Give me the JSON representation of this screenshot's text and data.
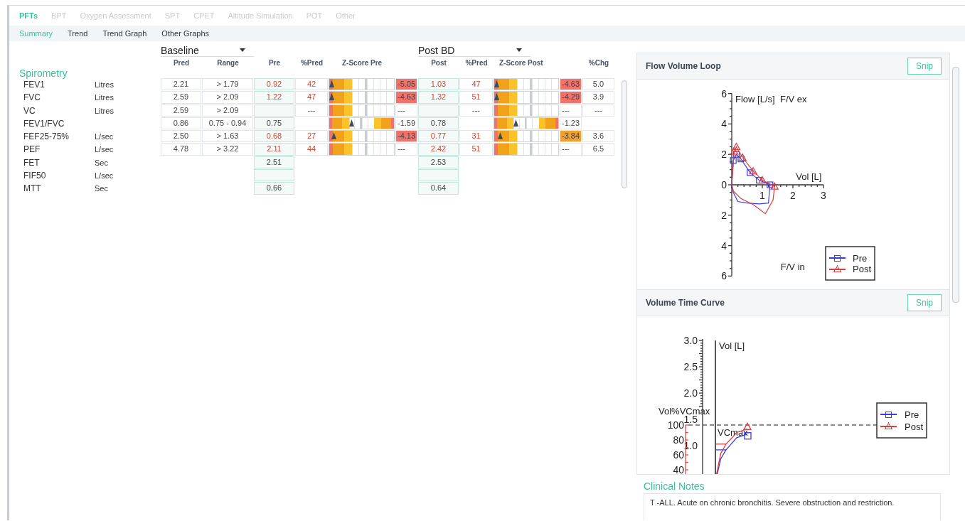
{
  "top_tabs": [
    {
      "label": "PFTs",
      "selected": true
    },
    {
      "label": "BPT",
      "selected": false
    },
    {
      "label": "Oxygen Assessment",
      "selected": false
    },
    {
      "label": "SPT",
      "selected": false
    },
    {
      "label": "CPET",
      "selected": false
    },
    {
      "label": "Altitude Simulation",
      "selected": false
    },
    {
      "label": "POT",
      "selected": false
    },
    {
      "label": "Other",
      "selected": false
    }
  ],
  "sub_tabs": [
    {
      "label": "Summary",
      "selected": true
    },
    {
      "label": "Trend",
      "selected": false
    },
    {
      "label": "Trend Graph",
      "selected": false
    },
    {
      "label": "Other Graphs",
      "selected": false
    }
  ],
  "baseline_select": {
    "value": "Baseline"
  },
  "post_select": {
    "value": "Post BD"
  },
  "columns": [
    "Pred",
    "Range",
    "Pre",
    "%Pred",
    "Z-Score Pre",
    "Post",
    "%Pred",
    "Z-Score Post",
    "%Chg"
  ],
  "section": "Spirometry",
  "rows": [
    {
      "name": "FEV1",
      "unit": "Litres",
      "pred": "2.21",
      "range": "> 1.79",
      "pre": {
        "text": "0.92",
        "low": true
      },
      "pre_pct": {
        "text": "42",
        "low": true
      },
      "z_pre": {
        "kind": "lower",
        "level": 0,
        "text": "-5.05",
        "color": "#f0726a"
      },
      "post": {
        "text": "1.03",
        "low": true
      },
      "post_pct": {
        "text": "47",
        "low": true
      },
      "z_post": {
        "kind": "lower",
        "level": 0,
        "text": "-4.63",
        "color": "#f0726a"
      },
      "chg": "5.0"
    },
    {
      "name": "FVC",
      "unit": "Litres",
      "pred": "2.59",
      "range": "> 2.09",
      "pre": {
        "text": "1.22",
        "low": true
      },
      "pre_pct": {
        "text": "47",
        "low": true
      },
      "z_pre": {
        "kind": "lower",
        "level": 0,
        "text": "-4.63",
        "color": "#f0726a"
      },
      "post": {
        "text": "1.32",
        "low": true
      },
      "post_pct": {
        "text": "51",
        "low": true
      },
      "z_post": {
        "kind": "lower",
        "level": 0,
        "text": "-4.29",
        "color": "#f0726a"
      },
      "chg": "3.9"
    },
    {
      "name": "VC",
      "unit": "Litres",
      "pred": "2.59",
      "range": "> 2.09",
      "pre": null,
      "pre_pct": {
        "text": "---",
        "low": false
      },
      "z_pre": {
        "kind": "lower",
        "text": "---",
        "color": "#ffffff"
      },
      "post": null,
      "post_pct": {
        "text": "---",
        "low": false
      },
      "z_post": {
        "kind": "lower",
        "text": "---",
        "color": "#ffffff"
      },
      "chg": "---"
    },
    {
      "name": "FEV1/FVC",
      "pred": "0.86",
      "range": "0.75 - 0.94",
      "pre": {
        "text": "0.75",
        "low": false
      },
      "z_pre": {
        "kind": "two_sided",
        "level": 0.33,
        "text": "-1.59",
        "color": "#ffffff"
      },
      "post": {
        "text": "0.78",
        "low": false
      },
      "z_post": {
        "kind": "two_sided",
        "level": 0.33,
        "text": "-1.23",
        "color": "#ffffff"
      }
    },
    {
      "name": "FEF25-75%",
      "unit": "L/sec",
      "pred": "2.50",
      "range": "> 1.63",
      "pre": {
        "text": "0.68",
        "low": true
      },
      "pre_pct": {
        "text": "27",
        "low": true
      },
      "z_pre": {
        "kind": "lower",
        "level": 0.04,
        "text": "-4.13",
        "color": "#f0726a"
      },
      "post": {
        "text": "0.77",
        "low": true
      },
      "post_pct": {
        "text": "31",
        "low": true
      },
      "z_post": {
        "kind": "lower",
        "level": 0.06,
        "text": "-3.84",
        "color": "#f0a02e"
      },
      "chg": "3.6"
    },
    {
      "name": "PEF",
      "unit": "L/sec",
      "pred": "4.78",
      "range": "> 3.22",
      "pre": {
        "text": "2.11",
        "low": true
      },
      "pre_pct": {
        "text": "44",
        "low": true
      },
      "z_pre": {
        "kind": "lower",
        "text": "---",
        "color": "#ffffff"
      },
      "post": {
        "text": "2.42",
        "low": true
      },
      "post_pct": {
        "text": "51",
        "low": true
      },
      "z_post": {
        "kind": "lower",
        "text": "---",
        "color": "#ffffff"
      },
      "chg": "6.5"
    },
    {
      "name": "FET",
      "unit": "Sec",
      "pre": {
        "text": "2.51",
        "low": false
      },
      "post": {
        "text": "2.53",
        "low": false
      }
    },
    {
      "name": "FIF50",
      "unit": "L/sec",
      "pre": null,
      "post": null
    },
    {
      "name": "MTT",
      "unit": "Sec",
      "pre": {
        "text": "0.66",
        "low": false
      },
      "post": {
        "text": "0.64",
        "low": false
      }
    }
  ],
  "flow_volume_panel": {
    "title": "Flow Volume Loop",
    "button": "Snip",
    "y_label": "Flow [L/s]",
    "top_note": "F/V ex",
    "x_label": "Vol [L]",
    "bottom_note": "F/V in",
    "y_ticks": [
      "6",
      "4",
      "2",
      "0",
      "2",
      "4",
      "6"
    ],
    "x_ticks": [
      "1",
      "2",
      "3"
    ],
    "legend": [
      {
        "name": "Pre",
        "color": "#3b3be6"
      },
      {
        "name": "Post",
        "color": "#e03a3a"
      }
    ]
  },
  "volume_time_panel": {
    "title": "Volume Time Curve",
    "button": "Snip",
    "y_label": "Vol [L]",
    "y_ticks": [
      "3.0",
      "2.5",
      "2.0",
      "1.5",
      "1.0"
    ],
    "percent_label": "Vol%VCmax",
    "percent_ticks": [
      "100",
      "80",
      "60",
      "40"
    ],
    "note": "VCmax",
    "legend": [
      {
        "name": "Pre",
        "color": "#3b3be6"
      },
      {
        "name": "Post",
        "color": "#e03a3a"
      }
    ]
  },
  "notes": {
    "label": "Clinical Notes",
    "text": "T -ALL. Acute on chronic bronchitis. Severe obstruction and restriction."
  }
}
